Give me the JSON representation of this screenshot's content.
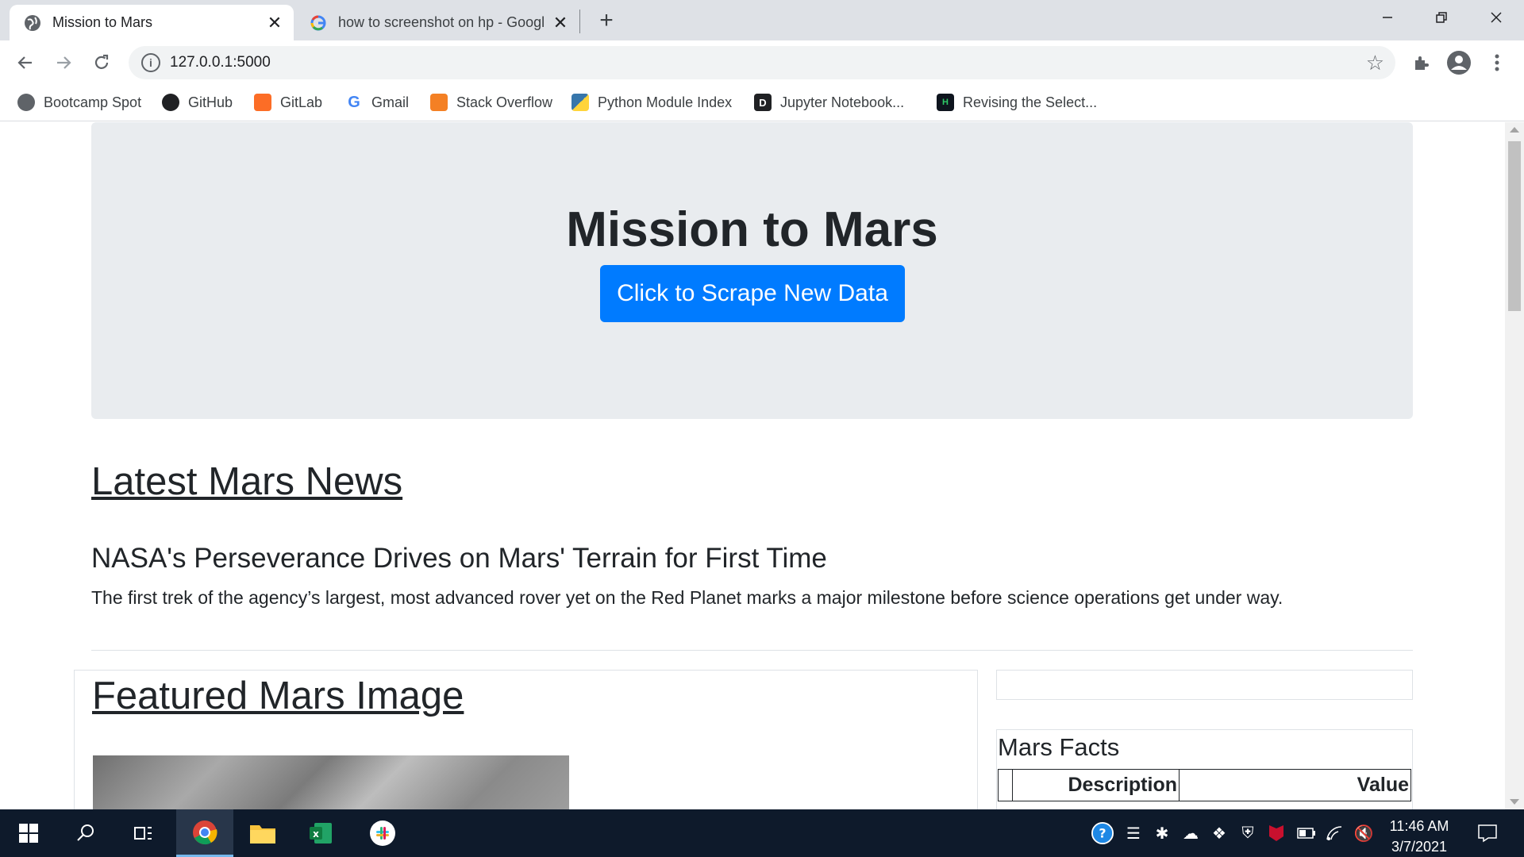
{
  "browser": {
    "tabs": [
      {
        "title": "Mission to Mars",
        "active": true,
        "icon": "globe-icon"
      },
      {
        "title": "how to screenshot on hp - Googl",
        "active": false,
        "icon": "google-icon"
      }
    ],
    "url": "127.0.0.1:5000",
    "bookmarks": [
      {
        "label": "Bootcamp Spot",
        "icon": "globe-icon"
      },
      {
        "label": "GitHub",
        "icon": "github-icon"
      },
      {
        "label": "GitLab",
        "icon": "gitlab-icon"
      },
      {
        "label": "Gmail",
        "icon": "google-icon"
      },
      {
        "label": "Stack Overflow",
        "icon": "stackoverflow-icon"
      },
      {
        "label": "Python Module Index",
        "icon": "python-icon"
      },
      {
        "label": "Jupyter Notebook...",
        "icon": "jupyter-icon"
      },
      {
        "label": "Revising the Select...",
        "icon": "hackerrank-icon"
      }
    ]
  },
  "page": {
    "jumbotron": {
      "title": "Mission to Mars",
      "button_label": "Click to Scrape New Data"
    },
    "news": {
      "heading": "Latest Mars News",
      "title": "NASA's Perseverance Drives on Mars' Terrain for First Time",
      "paragraph": "The first trek of the agency’s largest, most advanced rover yet on the Red Planet marks a major milestone before science operations get under way."
    },
    "featured": {
      "heading": "Featured Mars Image"
    },
    "facts": {
      "heading": "Mars Facts",
      "columns": [
        "",
        "Description",
        "Value"
      ]
    }
  },
  "taskbar": {
    "time": "11:46 AM",
    "date": "3/7/2021"
  },
  "colors": {
    "primary_button": "#007bff",
    "jumbotron_bg": "#e9ecef",
    "taskbar_bg": "#0e1a2b"
  }
}
